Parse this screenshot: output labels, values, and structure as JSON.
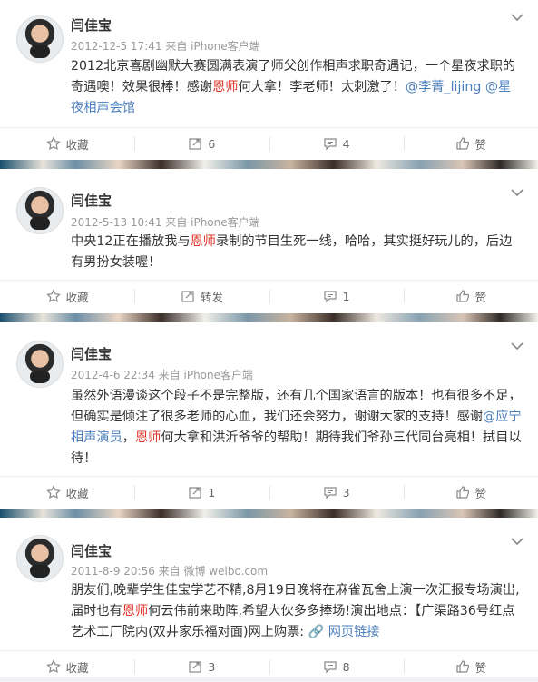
{
  "posts": [
    {
      "author": "闫佳宝",
      "meta": "2012-12-5 17:41 来自 iPhone客户端",
      "content_parts": [
        {
          "text": "2012北京喜剧幽默大赛圆满表演了师父创作相声求职奇遇记，一个星夜求职的奇遇噢！效果很棒！感谢",
          "style": "plain"
        },
        {
          "text": "恩师",
          "style": "hl"
        },
        {
          "text": "何大拿！李老师！太刺激了！",
          "style": "plain"
        },
        {
          "text": "@李菁_lijing",
          "style": "at"
        },
        {
          "text": " ",
          "style": "plain"
        },
        {
          "text": "@星夜相声会馆",
          "style": "at"
        }
      ],
      "actions": {
        "fav": "收藏",
        "repost": "6",
        "comment": "4",
        "like": "赞"
      }
    },
    {
      "author": "闫佳宝",
      "meta": "2012-5-13 10:41 来自 iPhone客户端",
      "content_parts": [
        {
          "text": "中央12正在播放我与",
          "style": "plain"
        },
        {
          "text": "恩师",
          "style": "hl"
        },
        {
          "text": "录制的节目生死一线，哈哈，其实挺好玩儿的，后边有男扮女装喔！",
          "style": "plain"
        }
      ],
      "actions": {
        "fav": "收藏",
        "repost": "转发",
        "comment": "1",
        "like": "赞"
      }
    },
    {
      "author": "闫佳宝",
      "meta": "2012-4-6 22:34 来自 iPhone客户端",
      "content_parts": [
        {
          "text": "虽然外语漫谈这个段子不是完整版，还有几个国家语言的版本！也有很多不足，但确实是倾注了很多老师的心血，我们还会努力，谢谢大家的支持！感谢",
          "style": "plain"
        },
        {
          "text": "@应宁相声演员",
          "style": "at"
        },
        {
          "text": "，",
          "style": "plain"
        },
        {
          "text": "恩师",
          "style": "hl"
        },
        {
          "text": "何大拿和洪沂爷爷的帮助！期待我们爷孙三代同台亮相！拭目以待！",
          "style": "plain"
        }
      ],
      "actions": {
        "fav": "收藏",
        "repost": "1",
        "comment": "3",
        "like": "赞"
      }
    },
    {
      "author": "闫佳宝",
      "meta": "2011-8-9 20:56 来自 微博 weibo.com",
      "content_parts": [
        {
          "text": "朋友们,晚辈学生佳宝学艺不精,8月19日晚将在麻雀瓦舍上演一次汇报专场演出,届时也有",
          "style": "plain"
        },
        {
          "text": "恩师",
          "style": "hl"
        },
        {
          "text": "何云伟前来助阵,希望大伙多多捧场!演出地点：【广渠路36号红点艺术工厂院内(双井家乐福对面)网上购票: ",
          "style": "plain"
        },
        {
          "text": "🔗 网页链接",
          "style": "at"
        }
      ],
      "actions": {
        "fav": "收藏",
        "repost": "3",
        "comment": "8",
        "like": "赞"
      }
    }
  ]
}
